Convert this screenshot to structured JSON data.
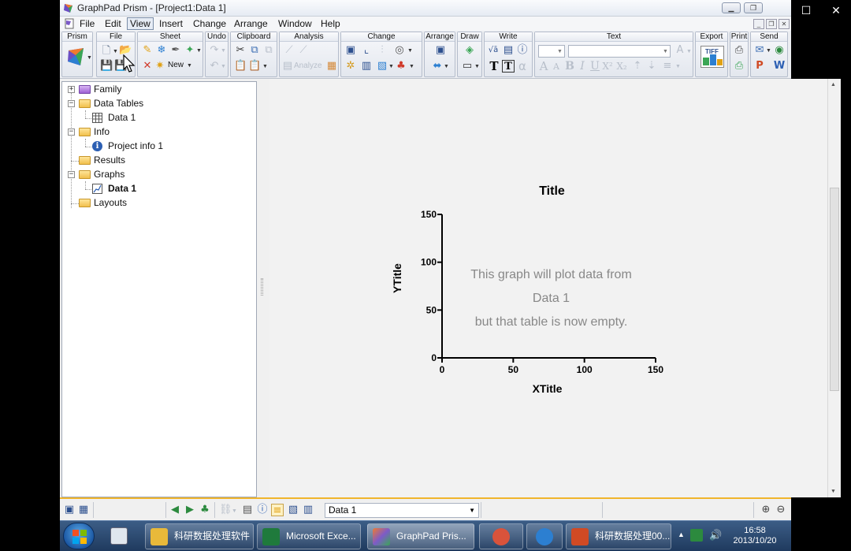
{
  "window": {
    "title": "GraphPad Prism - [Project1:Data 1]"
  },
  "menu": [
    "File",
    "Edit",
    "View",
    "Insert",
    "Change",
    "Arrange",
    "Window",
    "Help"
  ],
  "active_menu": "View",
  "toolbar": {
    "groups": [
      "Prism",
      "File",
      "Sheet",
      "Undo",
      "Clipboard",
      "Analysis",
      "Change",
      "Arrange",
      "Draw",
      "Write",
      "Text",
      "Export",
      "Print",
      "Send"
    ],
    "new_label": "New",
    "analyze_label": "Analyze",
    "tiff_label": "TIFF",
    "text_glyphs": {
      "bigT": "T",
      "boxT": "T",
      "alpha": "α",
      "growA": "A",
      "shrinkA": "A",
      "bold": "B",
      "italic": "I",
      "underline": "U",
      "superscript": "X²",
      "subscript": "X₂",
      "sqrt": "√ā"
    }
  },
  "navigator": {
    "items": [
      {
        "label": "Family",
        "type": "folder-purple",
        "expander": "+"
      },
      {
        "label": "Data Tables",
        "type": "folder",
        "expander": "−"
      },
      {
        "label": "Data 1",
        "type": "data-table"
      },
      {
        "label": "Info",
        "type": "folder",
        "expander": "−"
      },
      {
        "label": "Project info 1",
        "type": "info"
      },
      {
        "label": "Results",
        "type": "folder"
      },
      {
        "label": "Graphs",
        "type": "folder",
        "expander": "−"
      },
      {
        "label": "Data 1",
        "type": "graph",
        "bold": true
      },
      {
        "label": "Layouts",
        "type": "folder"
      }
    ]
  },
  "chart_data": {
    "type": "scatter",
    "title": "Title",
    "xlabel": "XTitle",
    "ylabel": "YTitle",
    "xlim": [
      0,
      150
    ],
    "ylim": [
      0,
      150
    ],
    "xticks": [
      0,
      50,
      100,
      150
    ],
    "yticks": [
      0,
      50,
      100,
      150
    ],
    "series": [],
    "empty_message": [
      "This graph will plot data from",
      "Data 1",
      "but that table is now empty."
    ]
  },
  "statusbar": {
    "sheet_select": "Data 1"
  },
  "taskbar": {
    "tasks": [
      {
        "label": "科研数据处理软件",
        "color": "#e8b93a"
      },
      {
        "label": "Microsoft Exce...",
        "color": "#1f7a3c"
      },
      {
        "label": "GraphPad Pris...",
        "color": "#7d5bc8",
        "active": true
      },
      {
        "label": "",
        "color": "#d9533b"
      },
      {
        "label": "",
        "color": "#2c7fd1"
      },
      {
        "label": "科研数据处理00...",
        "color": "#d04a24"
      }
    ],
    "time": "16:58",
    "date": "2013/10/20"
  }
}
